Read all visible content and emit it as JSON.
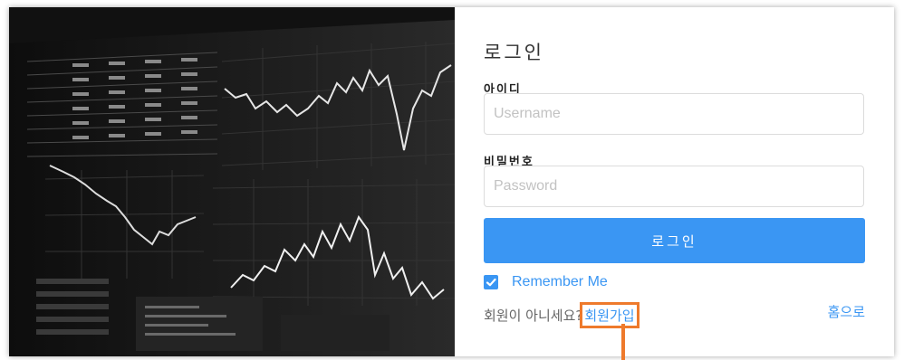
{
  "login": {
    "title": "로그인",
    "username_label": "아이디",
    "username_placeholder": "Username",
    "password_label": "비밀번호",
    "password_placeholder": "Password",
    "submit_label": "로그인",
    "remember_label": "Remember Me",
    "remember_checked": true,
    "signup_prompt": "회원이 아니세요?",
    "signup_link": "회원가입",
    "home_link": "홈으로"
  },
  "colors": {
    "accent": "#3a96f3",
    "highlight": "#ee7a2c"
  },
  "icons": {
    "checkbox": "check-icon"
  }
}
